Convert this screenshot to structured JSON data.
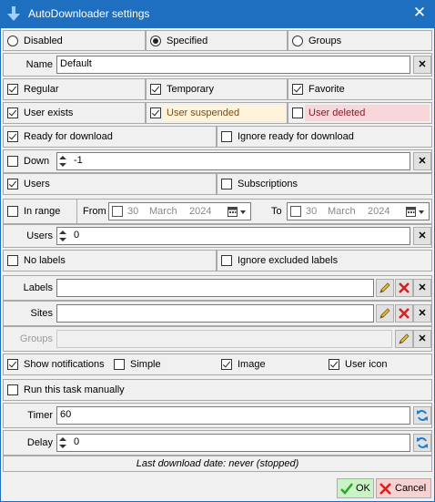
{
  "window": {
    "title": "AutoDownloader settings"
  },
  "mode": {
    "disabled_label": "Disabled",
    "specified_label": "Specified",
    "groups_label": "Groups",
    "selected": "Specified"
  },
  "name": {
    "label": "Name",
    "value": "Default"
  },
  "types": {
    "regular": {
      "label": "Regular",
      "checked": true
    },
    "temporary": {
      "label": "Temporary",
      "checked": true
    },
    "favorite": {
      "label": "Favorite",
      "checked": true
    },
    "user_exists": {
      "label": "User exists",
      "checked": true
    },
    "user_suspended": {
      "label": "User suspended",
      "checked": true,
      "color": "#fff3dc",
      "text_color": "#7b4f12"
    },
    "user_deleted": {
      "label": "User deleted",
      "checked": false,
      "color": "#f8d7da",
      "text_color": "#8b1a2b"
    }
  },
  "ready": {
    "ready_label": "Ready for download",
    "ready_checked": true,
    "ignore_label": "Ignore ready for download",
    "ignore_checked": false
  },
  "down": {
    "label": "Down",
    "checked": false,
    "value": "-1"
  },
  "users_subs": {
    "users_label": "Users",
    "users_checked": true,
    "subs_label": "Subscriptions",
    "subs_checked": false
  },
  "range": {
    "label": "In range",
    "checked": false,
    "from_label": "From",
    "from_day": "30",
    "from_month": "March",
    "from_year": "2024",
    "to_label": "To",
    "to_day": "30",
    "to_month": "March",
    "to_year": "2024"
  },
  "users_count": {
    "label": "Users",
    "value": "0"
  },
  "labels_opts": {
    "no_labels": "No labels",
    "no_labels_checked": false,
    "ignore_excluded": "Ignore excluded labels",
    "ignore_excluded_checked": false
  },
  "labels": {
    "label": "Labels",
    "value": ""
  },
  "sites": {
    "label": "Sites",
    "value": ""
  },
  "groups": {
    "label": "Groups",
    "value": ""
  },
  "notify": {
    "show_label": "Show notifications",
    "show_checked": true,
    "simple_label": "Simple",
    "simple_checked": false,
    "image_label": "Image",
    "image_checked": true,
    "usericon_label": "User icon",
    "usericon_checked": true
  },
  "manual": {
    "label": "Run this task manually",
    "checked": false
  },
  "timer": {
    "label": "Timer",
    "value": "60"
  },
  "delay": {
    "label": "Delay",
    "value": "0"
  },
  "status": {
    "text": "Last download date: never (stopped)"
  },
  "buttons": {
    "ok": "OK",
    "cancel": "Cancel"
  },
  "icons": {
    "title": "down-arrow-icon",
    "edit": "pencil-icon",
    "clear": "red-x-icon",
    "refresh": "refresh-icon",
    "calendar": "calendar-icon"
  },
  "colors": {
    "titlebar": "#1e6fc0",
    "ok_button": "#c9f5c5",
    "cancel_button": "#f7d2d2"
  }
}
